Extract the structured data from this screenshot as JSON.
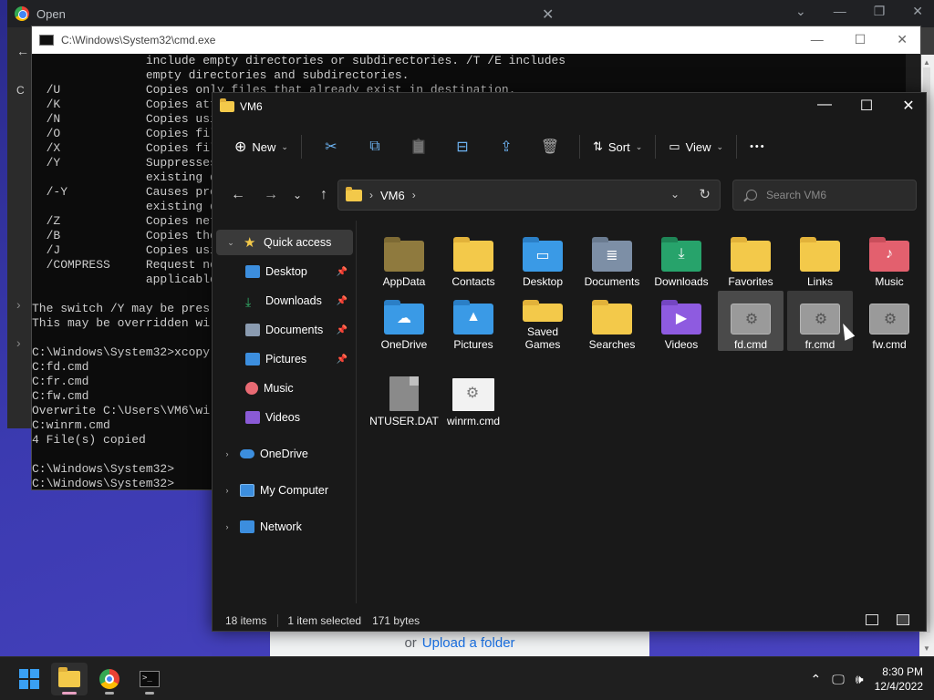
{
  "chrome": {
    "title": "Open",
    "close_glyph": "✕",
    "controls": [
      "⌄",
      "—",
      "❐",
      "✕"
    ],
    "side_glyphs": [
      "←",
      "C",
      "›",
      "›"
    ]
  },
  "upload": {
    "or_text": "or",
    "link_text": "Upload a folder"
  },
  "cmd": {
    "title": "C:\\Windows\\System32\\cmd.exe",
    "controls": [
      "—",
      "☐",
      "✕"
    ],
    "lines": [
      "                include empty directories or subdirectories. /T /E includes",
      "                empty directories and subdirectories.",
      "  /U            Copies only files that already exist in destination.",
      "  /K            Copies att",
      "  /N            Copies usi",
      "  /O            Copies fil",
      "  /X            Copies fil",
      "  /Y            Suppresses",
      "                existing d",
      "  /-Y           Causes pro",
      "                existing d",
      "  /Z            Copies net",
      "  /B            Copies the",
      "  /J            Copies usi",
      "  /COMPRESS     Request ne",
      "                applicable",
      "",
      "The switch /Y may be pres",
      "This may be overridden wi",
      "",
      "C:\\Windows\\System32>xcopy",
      "C:fd.cmd",
      "C:fr.cmd",
      "C:fw.cmd",
      "Overwrite C:\\Users\\VM6\\wi",
      "C:winrm.cmd",
      "4 File(s) copied",
      "",
      "C:\\Windows\\System32>",
      "C:\\Windows\\System32>"
    ]
  },
  "explorer": {
    "title": "VM6",
    "controls": [
      "—",
      "☐",
      "✕"
    ],
    "toolbar": {
      "new_label": "New",
      "sort_label": "Sort",
      "view_label": "View",
      "chev": "⌄",
      "more": "•••",
      "icons": {
        "new": "⊕",
        "cut": "✂",
        "copy": "⧉",
        "paste": "📋",
        "rename": "⊟",
        "share": "⇪",
        "delete": "🗑",
        "sort": "⇅",
        "view": "▭"
      }
    },
    "nav": {
      "back": "←",
      "forward": "→",
      "recent": "⌄",
      "up": "↑"
    },
    "address": {
      "path": "VM6",
      "sep": "›",
      "chev": "⌄",
      "refresh": "↻"
    },
    "search": {
      "placeholder": "Search VM6"
    },
    "nav_pane": {
      "quick_access": "Quick access",
      "pin": "📌",
      "expand": "›",
      "expanded": "⌄",
      "star": "★",
      "items": [
        {
          "label": "Desktop"
        },
        {
          "label": "Downloads"
        },
        {
          "label": "Documents"
        },
        {
          "label": "Pictures"
        },
        {
          "label": "Music"
        },
        {
          "label": "Videos"
        }
      ],
      "onedrive": "OneDrive",
      "my_computer": "My Computer",
      "network": "Network"
    },
    "files": [
      {
        "name": "AppData",
        "icon": "folder-dark",
        "glyph": ""
      },
      {
        "name": "Contacts",
        "icon": "folder",
        "glyph": ""
      },
      {
        "name": "Desktop",
        "icon": "blue",
        "glyph": "▭"
      },
      {
        "name": "Documents",
        "icon": "gray",
        "glyph": "≣"
      },
      {
        "name": "Downloads",
        "icon": "green",
        "glyph": "⤓"
      },
      {
        "name": "Favorites",
        "icon": "folder",
        "glyph": ""
      },
      {
        "name": "Links",
        "icon": "folder",
        "glyph": ""
      },
      {
        "name": "Music",
        "icon": "pink",
        "glyph": "♪"
      },
      {
        "name": "OneDrive",
        "icon": "blue",
        "glyph": "☁"
      },
      {
        "name": "Pictures",
        "icon": "blue",
        "glyph": "▲"
      },
      {
        "name": "Saved Games",
        "icon": "folder",
        "glyph": ""
      },
      {
        "name": "Searches",
        "icon": "folder",
        "glyph": ""
      },
      {
        "name": "Videos",
        "icon": "purple",
        "glyph": "▶"
      },
      {
        "name": "fd.cmd",
        "icon": "cmdfile",
        "glyph": "⚙"
      },
      {
        "name": "fr.cmd",
        "icon": "cmdfile",
        "glyph": "⚙"
      },
      {
        "name": "fw.cmd",
        "icon": "cmdfile",
        "glyph": "⚙"
      },
      {
        "name": "NTUSER.DAT",
        "icon": "blank",
        "glyph": ""
      },
      {
        "name": "winrm.cmd",
        "icon": "paper",
        "glyph": "⚙"
      }
    ],
    "status": {
      "count": "18 items",
      "selected": "1 item selected",
      "size": "171 bytes"
    }
  },
  "taskbar": {
    "cmd_glyph": ">_",
    "tray_up": "⌃",
    "tray_net": "🖵",
    "tray_vol": "🕪",
    "time": "8:30 PM",
    "date": "12/4/2022"
  }
}
